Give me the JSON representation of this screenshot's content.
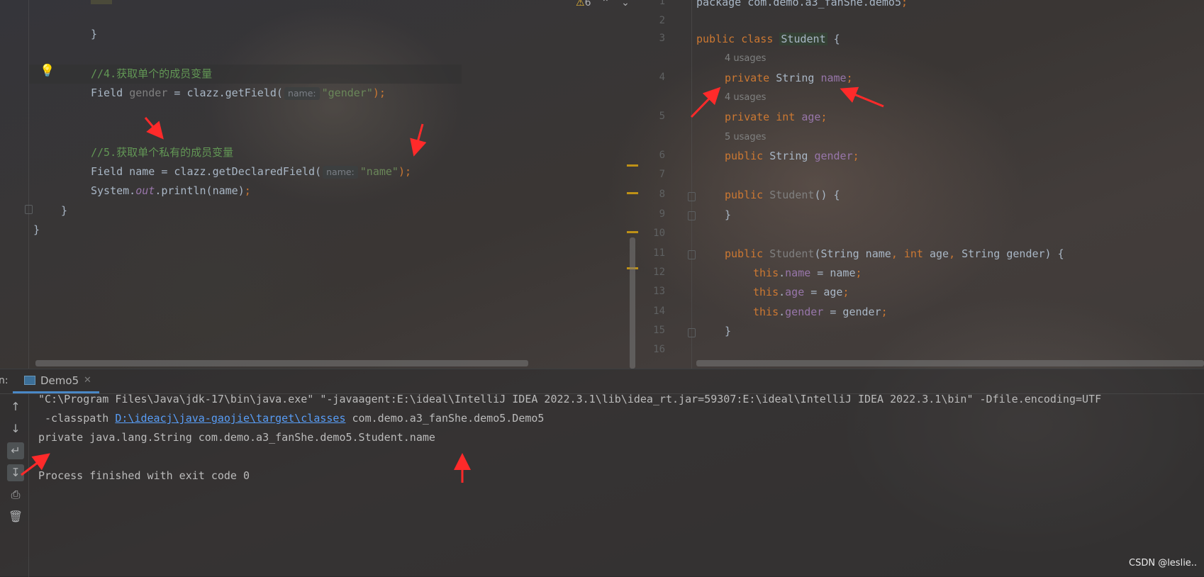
{
  "editor_left": {
    "lines": [
      [
        {
          "t": "}",
          "c": "plain"
        }
      ],
      [
        {
          "t": "//4.",
          "c": "cmt"
        },
        {
          "t": "获取单个的成员变量",
          "c": "cmt"
        }
      ],
      [
        {
          "t": "Field ",
          "c": "plain"
        },
        {
          "t": "gender",
          "c": "dim"
        },
        {
          "t": " = clazz.getField(",
          "c": "plain"
        },
        {
          "t": "name:",
          "c": "hint"
        },
        {
          "t": "\"gender\"",
          "c": "str"
        },
        {
          "t": ");",
          "c": "kw"
        }
      ],
      [
        {
          "t": "//5.获取单个私有的成员变量",
          "c": "cmt"
        }
      ],
      [
        {
          "t": "Field name = clazz.getDeclaredField(",
          "c": "plain"
        },
        {
          "t": "name:",
          "c": "hint"
        },
        {
          "t": "\"name\"",
          "c": "str"
        },
        {
          "t": ");",
          "c": "kw"
        }
      ],
      [
        {
          "t": "System.",
          "c": "plain"
        },
        {
          "t": "out",
          "c": "stat"
        },
        {
          "t": ".println(name)",
          "c": "plain"
        },
        {
          "t": ";",
          "c": "kw"
        }
      ],
      [
        {
          "t": "}",
          "c": "plain"
        }
      ],
      [
        {
          "t": "}",
          "c": "plain"
        }
      ]
    ],
    "warning_count": "6"
  },
  "editor_right": {
    "line_numbers": [
      "1",
      "2",
      "3",
      "4",
      "5",
      "6",
      "7",
      "8",
      "9",
      "10",
      "11",
      "12",
      "13",
      "14",
      "15",
      "16"
    ],
    "usages": [
      "4 usages",
      "4 usages",
      "5 usages"
    ],
    "lines": [
      [
        {
          "t": "package com.demo.a3_fanShe.demo5",
          "c": "plain"
        },
        {
          "t": ";",
          "c": "kw"
        }
      ],
      [
        {
          "t": "public class ",
          "c": "kw"
        },
        {
          "t": "Student",
          "c": "clshl"
        },
        {
          "t": " {",
          "c": "plain"
        }
      ],
      [
        {
          "t": "private ",
          "c": "kw"
        },
        {
          "t": "String ",
          "c": "plain"
        },
        {
          "t": "name",
          "c": "fld"
        },
        {
          "t": ";",
          "c": "kw"
        }
      ],
      [
        {
          "t": "private int ",
          "c": "kw"
        },
        {
          "t": "age",
          "c": "fld"
        },
        {
          "t": ";",
          "c": "kw"
        }
      ],
      [
        {
          "t": "public ",
          "c": "kw"
        },
        {
          "t": "String ",
          "c": "plain"
        },
        {
          "t": "gender",
          "c": "fld"
        },
        {
          "t": ";",
          "c": "kw"
        }
      ],
      [
        {
          "t": "public ",
          "c": "kw"
        },
        {
          "t": "Student",
          "c": "dim"
        },
        {
          "t": "() {",
          "c": "plain"
        }
      ],
      [
        {
          "t": "}",
          "c": "plain"
        }
      ],
      [
        {
          "t": "public ",
          "c": "kw"
        },
        {
          "t": "Student",
          "c": "dim"
        },
        {
          "t": "(String name",
          "c": "plain"
        },
        {
          "t": ", int ",
          "c": "kw"
        },
        {
          "t": "age",
          "c": "plain"
        },
        {
          "t": ", ",
          "c": "kw"
        },
        {
          "t": "String gender) {",
          "c": "plain"
        }
      ],
      [
        {
          "t": "this",
          "c": "kw"
        },
        {
          "t": ".",
          "c": "plain"
        },
        {
          "t": "name",
          "c": "fld"
        },
        {
          "t": " = name",
          "c": "plain"
        },
        {
          "t": ";",
          "c": "kw"
        }
      ],
      [
        {
          "t": "this",
          "c": "kw"
        },
        {
          "t": ".",
          "c": "plain"
        },
        {
          "t": "age",
          "c": "fld"
        },
        {
          "t": " = age",
          "c": "plain"
        },
        {
          "t": ";",
          "c": "kw"
        }
      ],
      [
        {
          "t": "this",
          "c": "kw"
        },
        {
          "t": ".",
          "c": "plain"
        },
        {
          "t": "gender",
          "c": "fld"
        },
        {
          "t": " = gender",
          "c": "plain"
        },
        {
          "t": ";",
          "c": "kw"
        }
      ],
      [
        {
          "t": "}",
          "c": "plain"
        }
      ]
    ]
  },
  "run_panel": {
    "label": "n:",
    "tab": "Demo5",
    "console": [
      "\"C:\\Program Files\\Java\\jdk-17\\bin\\java.exe\" \"-javaagent:E:\\ideal\\IntelliJ IDEA 2022.3.1\\lib\\idea_rt.jar=59307:E:\\ideal\\IntelliJ IDEA 2022.3.1\\bin\" -Dfile.encoding=UTF",
      " -classpath ",
      "D:\\ideacj\\java-gaojie\\target\\classes",
      " com.demo.a3_fanShe.demo5.Demo5",
      "private java.lang.String com.demo.a3_fanShe.demo5.Student.name",
      "Process finished with exit code 0"
    ]
  },
  "watermark": "CSDN @leslie..",
  "colors": {
    "keyword": "#cc7832",
    "string": "#6a8759",
    "comment": "#629755",
    "field": "#9876aa",
    "annotation_arrow": "#ff2a2a",
    "link": "#589df6"
  }
}
